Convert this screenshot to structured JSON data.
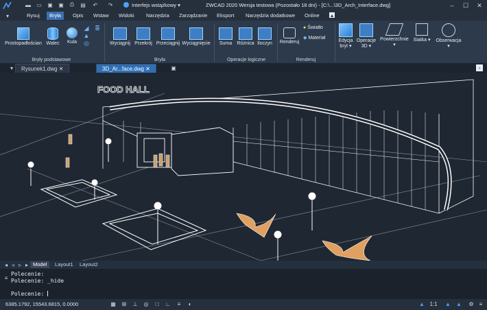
{
  "titlebar": {
    "workspace": "Interfejs wstążkowy",
    "title": "ZWCAD 2020 Wersja testowa (Pozostało 18 dni) - [C:\\...\\3D_Arch_Interface.dwg]"
  },
  "menu": {
    "items": [
      "Rysuj",
      "Bryła",
      "Opis",
      "Wstaw",
      "Widoki",
      "Narzędzia",
      "Zarządzanie",
      "Eksport",
      "Narzędzia dodatkowe",
      "Online"
    ],
    "active_index": 1
  },
  "ribbon": {
    "solid_basic": {
      "prostopadloscian": "Prostopadłościan",
      "walec": "Walec",
      "kula": "Kula",
      "group": "Bryły podstawowe"
    },
    "solid": {
      "wyciagnij": "Wyciągnij",
      "przekroj": "Przekrój",
      "przeciagnij": "Przeciągnij",
      "wyciagniecie": "Wyciągnięcie",
      "group": "Bryła"
    },
    "boolean": {
      "suma": "Suma",
      "roznica": "Różnica",
      "iloczyn": "Iloczyn",
      "group": "Operacje logiczne"
    },
    "render": {
      "renderuj": "Renderuj",
      "swiatlo": "Światło",
      "material": "Materiał",
      "group": "Renderuj"
    },
    "edycja": "Edycja bryt",
    "operacje3d": "Operacje 3D",
    "powierzchnie": "Powierzchnie",
    "siatka": "Siatka",
    "obserwacja": "Obserwacja"
  },
  "doc_tabs": [
    "Rysunek1.dwg",
    "3D_Ar...face.dwg"
  ],
  "layout_tabs": [
    "Model",
    "Layout1",
    "Layout2"
  ],
  "viewport": {
    "sign": "FOOD HALL"
  },
  "command": {
    "history": [
      "Polecenie:",
      "Polecenie:  _hide"
    ],
    "prompt": "Polecenie:"
  },
  "status": {
    "coords": "6385.1792, 15543.6815, 0.0000",
    "scale": "1:1"
  },
  "colors": {
    "accent": "#3b6fb0",
    "background": "#1f2733",
    "wire": "#ffffff",
    "pattern": "#e0a060"
  }
}
